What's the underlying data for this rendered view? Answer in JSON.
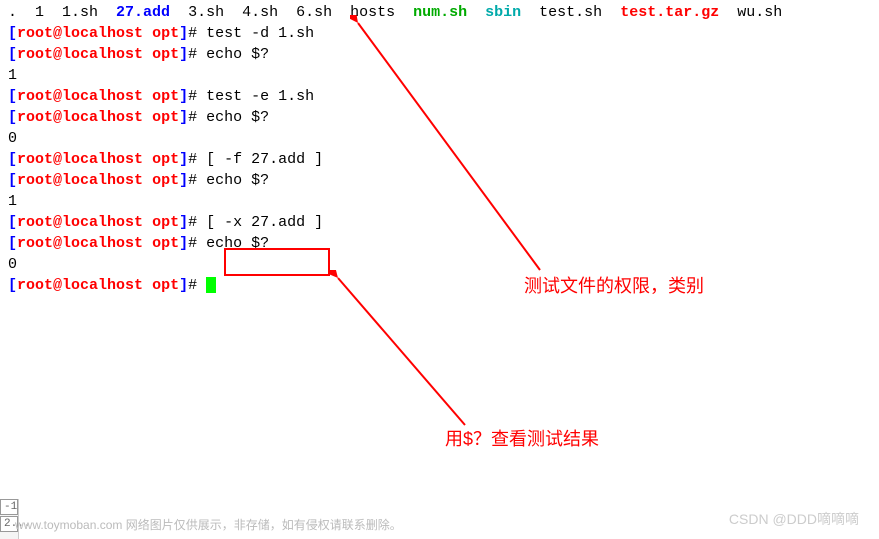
{
  "ls_line": {
    "items": [
      {
        "text": ".",
        "cls": "ls-dot"
      },
      {
        "text": "  1  1.sh  ",
        "cls": "ls-num"
      },
      {
        "text": "27.add",
        "cls": "ls-blue"
      },
      {
        "text": "  3.sh  4.sh  6.sh  hosts  ",
        "cls": "ls-num"
      },
      {
        "text": "num.sh",
        "cls": "ls-exec"
      },
      {
        "text": "  ",
        "cls": "ls-num"
      },
      {
        "text": "sbin",
        "cls": "ls-cyan"
      },
      {
        "text": "  test.sh  ",
        "cls": "ls-num"
      },
      {
        "text": "test.tar.gz",
        "cls": "ls-red"
      },
      {
        "text": "  wu.sh",
        "cls": "ls-num"
      }
    ]
  },
  "prompt": {
    "open": "[",
    "user": "root",
    "at": "@",
    "host": "localhost",
    "space": " ",
    "path": "opt",
    "close": "]",
    "hash": "# "
  },
  "lines": [
    {
      "type": "cmd",
      "text": "test -d 1.sh"
    },
    {
      "type": "cmd",
      "text": "echo $?"
    },
    {
      "type": "out",
      "text": "1"
    },
    {
      "type": "cmd",
      "text": "test -e 1.sh"
    },
    {
      "type": "cmd",
      "text": "echo $?"
    },
    {
      "type": "out",
      "text": "0"
    },
    {
      "type": "cmd",
      "text": "[ -f 27.add ]"
    },
    {
      "type": "cmd",
      "text": "echo $?"
    },
    {
      "type": "out",
      "text": "1"
    },
    {
      "type": "cmd",
      "text": "[ -x 27.add ]"
    },
    {
      "type": "cmd",
      "text": "echo $?"
    },
    {
      "type": "out",
      "text": "0"
    },
    {
      "type": "cursor",
      "text": ""
    }
  ],
  "annotations": {
    "top": "测试文件的权限，类别",
    "bottom": "用$？查看测试结果"
  },
  "watermark": {
    "left": "www.toymoban.com 网络图片仅供展示，非存储，如有侵权请联系删除。",
    "right": "CSDN @DDD嘀嘀嘀"
  },
  "tabs": {
    "t1": "-1",
    "t2": "2..."
  }
}
